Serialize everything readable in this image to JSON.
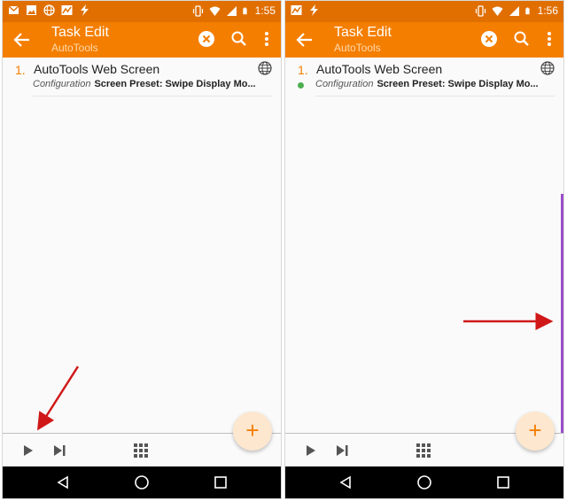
{
  "screens": [
    {
      "status_time": "1:55",
      "title": "Task Edit",
      "subtitle": "AutoTools",
      "task": {
        "number": "1.",
        "name": "AutoTools Web Screen",
        "config_label": "Configuration",
        "config_value": "Screen Preset: Swipe Display Mo..."
      },
      "fab_label": "+"
    },
    {
      "status_time": "1:56",
      "title": "Task Edit",
      "subtitle": "AutoTools",
      "task": {
        "number": "1.",
        "name": "AutoTools Web Screen",
        "config_label": "Configuration",
        "config_value": "Screen Preset: Swipe Display Mo..."
      },
      "fab_label": "+"
    }
  ],
  "colors": {
    "app_bar": "#f47e00",
    "status_bar": "#e06f00",
    "status_dot": "#4caf50",
    "annotation_arrow": "#d01818",
    "edge_bar": "#9c4dcc"
  },
  "icons": {
    "status_left_1": [
      "mail-icon",
      "image-icon",
      "globe-icon",
      "chart-icon",
      "flash-icon"
    ],
    "status_left_2": [
      "chart-icon",
      "flash-icon"
    ],
    "status_right": [
      "vibrate-icon",
      "wifi-icon",
      "cell-signal-icon",
      "battery-icon"
    ],
    "app_bar": [
      "back-arrow-icon",
      "clear-icon",
      "search-icon",
      "more-vert-icon"
    ],
    "bottom_bar": [
      "play-icon",
      "step-icon",
      "grid-icon"
    ],
    "nav_bar": [
      "nav-back-icon",
      "nav-home-icon",
      "nav-recents-icon"
    ]
  }
}
